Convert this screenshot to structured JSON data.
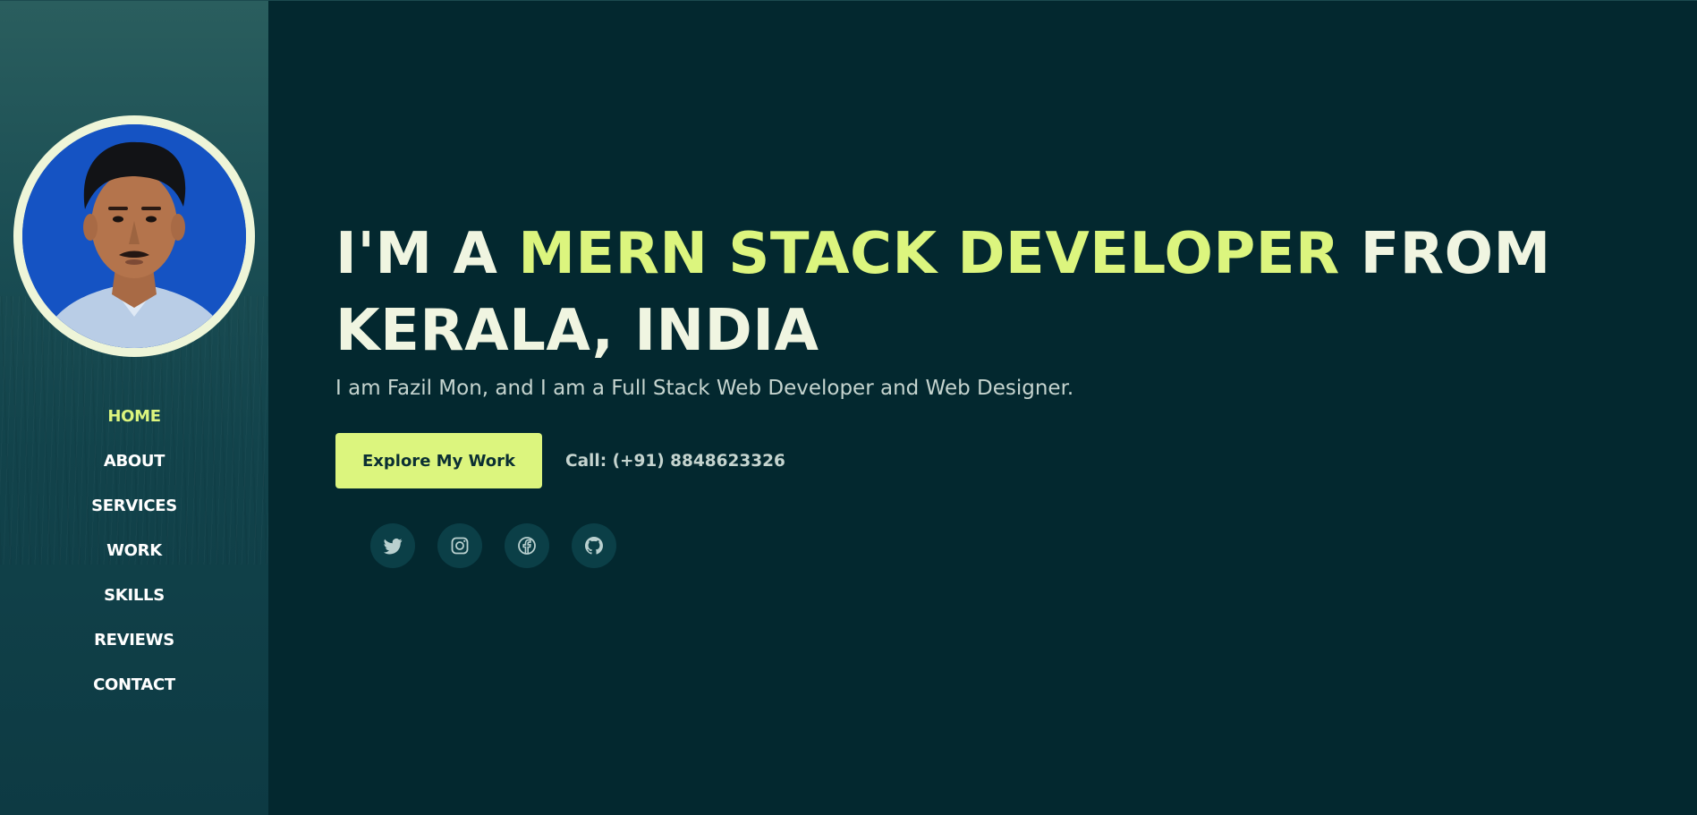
{
  "sidebar": {
    "avatar_alt": "Fazil Mon",
    "nav": [
      {
        "label": "HOME",
        "active": true
      },
      {
        "label": "ABOUT",
        "active": false
      },
      {
        "label": "SERVICES",
        "active": false
      },
      {
        "label": "WORK",
        "active": false
      },
      {
        "label": "SKILLS",
        "active": false
      },
      {
        "label": "REVIEWS",
        "active": false
      },
      {
        "label": "CONTACT",
        "active": false
      }
    ]
  },
  "hero": {
    "headline_prefix": "I'M A ",
    "headline_accent": "MERN STACK DEVELOPER",
    "headline_suffix": " FROM KERALA, INDIA",
    "subtitle": "I am Fazil Mon, and I am a Full Stack Web Developer and Web Designer.",
    "cta_label": "Explore My Work",
    "call_text": "Call: (+91) 8848623326"
  },
  "socials": [
    {
      "icon": "twitter-icon"
    },
    {
      "icon": "instagram-icon"
    },
    {
      "icon": "facebook-icon"
    },
    {
      "icon": "github-icon"
    }
  ],
  "colors": {
    "background": "#03282f",
    "accent": "#dcf57e",
    "headline_text": "#f0f5e1",
    "body_text": "#c5d4cf",
    "social_bg": "#0b3f47"
  }
}
